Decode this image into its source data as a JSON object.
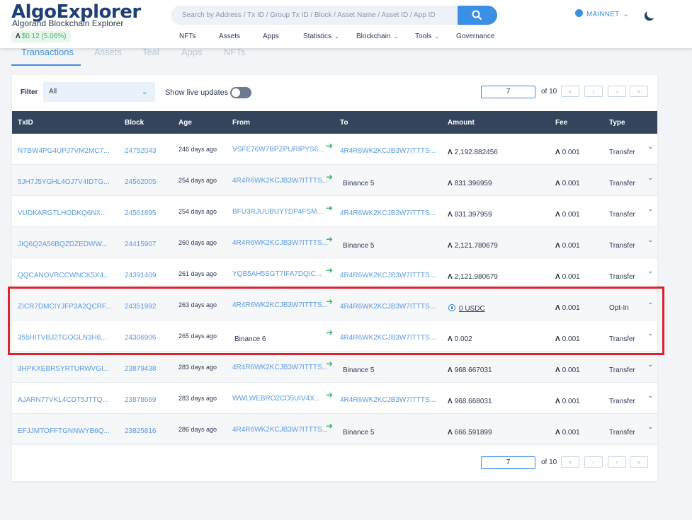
{
  "header": {
    "logo": "AlgoExplorer",
    "subtitle": "Algorand Blockchain Explorer",
    "price": "$0.12 (5.06%)",
    "price_symbol": "Ʌ",
    "search_placeholder": "Search by Address / Tx ID / Group Tx ID / Block / Asset Name / Asset ID / App ID",
    "nav": [
      "NFTs",
      "Assets",
      "Apps",
      "Statistics",
      "Blockchain",
      "Tools",
      "Governance"
    ],
    "network": "MAINNET",
    "dropdown_chevron": "⌄"
  },
  "tabs": [
    "Transactions",
    "Assets",
    "Teal",
    "Apps",
    "NFTs"
  ],
  "filter": {
    "label": "Filter",
    "value": "All",
    "live_label": "Show live updates",
    "live_on": false
  },
  "pagination": {
    "page": "7",
    "of_label": "of 10",
    "first": "«",
    "prev": "‹",
    "next": "›",
    "last": "»"
  },
  "table": {
    "columns": [
      "TxID",
      "Block",
      "Age",
      "From",
      "To",
      "Amount",
      "Fee",
      "Type"
    ],
    "rows": [
      {
        "txid": "NTBW4PG4UPJ7VM2MC7...",
        "block": "24752043",
        "age": "246 days ago",
        "from": "VSFE76W7BPZPURIPYS6...",
        "from_link": true,
        "to": "4R4R6WK2KCJB3W7ITTTS...",
        "to_link": true,
        "amount": "2,192.882456",
        "amount_kind": "algo",
        "fee": "0.001",
        "type": "Transfer"
      },
      {
        "txid": "5JH7J5YGHL4OJ7V4IDTG...",
        "block": "24562005",
        "age": "254 days ago",
        "from": "4R4R6WK2KCJB3W7ITTTS...",
        "from_link": true,
        "to": "Binance 5",
        "to_link": false,
        "amount": "831.396959",
        "amount_kind": "algo",
        "fee": "0.001",
        "type": "Transfer"
      },
      {
        "txid": "VUDKARGTLHODKQ6NX...",
        "block": "24561895",
        "age": "254 days ago",
        "from": "BFU3RJUUBUYTDP4FSM...",
        "from_link": true,
        "to": "4R4R6WK2KCJB3W7ITTTS...",
        "to_link": true,
        "amount": "831.397959",
        "amount_kind": "algo",
        "fee": "0.001",
        "type": "Transfer"
      },
      {
        "txid": "JIQ6Q2A56BQZDZEDWW...",
        "block": "24415907",
        "age": "260 days ago",
        "from": "4R4R6WK2KCJB3W7ITTTS...",
        "from_link": true,
        "to": "Binance 5",
        "to_link": false,
        "amount": "2,121.780679",
        "amount_kind": "algo",
        "fee": "0.001",
        "type": "Transfer"
      },
      {
        "txid": "QQCANOVRCCWNCK5X4...",
        "block": "24391409",
        "age": "261 days ago",
        "from": "YQB5AH5SGT7IFA7DQIC...",
        "from_link": true,
        "to": "4R4R6WK2KCJB3W7ITTTS...",
        "to_link": true,
        "amount": "2,121.980679",
        "amount_kind": "algo",
        "fee": "0.001",
        "type": "Transfer"
      },
      {
        "txid": "ZICR7DMCIYJFP3A2QCRF...",
        "block": "24351992",
        "age": "263 days ago",
        "from": "4R4R6WK2KCJB3W7ITTTS...",
        "from_link": true,
        "to": "4R4R6WK2KCJB3W7ITTTS...",
        "to_link": true,
        "amount": "0 USDC",
        "amount_kind": "usdc",
        "fee": "0.001",
        "type": "Opt-In"
      },
      {
        "txid": "355HITVBJ2TGOGLN3H6...",
        "block": "24306906",
        "age": "265 days ago",
        "from": "Binance 6",
        "from_link": false,
        "to": "4R4R6WK2KCJB3W7ITTTS...",
        "to_link": true,
        "amount": "0.002",
        "amount_kind": "algo",
        "fee": "0.001",
        "type": "Transfer"
      },
      {
        "txid": "3HPKXEBRSYRTURWVGI...",
        "block": "23879438",
        "age": "283 days ago",
        "from": "4R4R6WK2KCJB3W7ITTTS...",
        "from_link": true,
        "to": "Binance 5",
        "to_link": false,
        "amount": "968.667031",
        "amount_kind": "algo",
        "fee": "0.001",
        "type": "Transfer"
      },
      {
        "txid": "AJARN77VKL4CDT5JTTQ...",
        "block": "23878669",
        "age": "283 days ago",
        "from": "WWLWEBRO2CD5UIV4X...",
        "from_link": true,
        "to": "4R4R6WK2KCJB3W7ITTTS...",
        "to_link": true,
        "amount": "968.668031",
        "amount_kind": "algo",
        "fee": "0.001",
        "type": "Transfer"
      },
      {
        "txid": "EFJJMTOFFTGNNWYB6Q...",
        "block": "23825816",
        "age": "286 days ago",
        "from": "4R4R6WK2KCJB3W7ITTTS...",
        "from_link": true,
        "to": "Binance 5",
        "to_link": false,
        "amount": "666.591899",
        "amount_kind": "algo",
        "fee": "0.001",
        "type": "Transfer"
      }
    ]
  },
  "colors": {
    "accent": "#3b90e3",
    "header_bg": "#33445c",
    "link": "#5a9be0",
    "arrow": "#43b36a",
    "highlight": "#d9242e"
  },
  "icons": {
    "search": "search-icon",
    "arrow": "arrow-right-icon",
    "row_expand": "chevron-down-icon",
    "algo": "algo-icon",
    "usdc": "usdc-icon"
  }
}
